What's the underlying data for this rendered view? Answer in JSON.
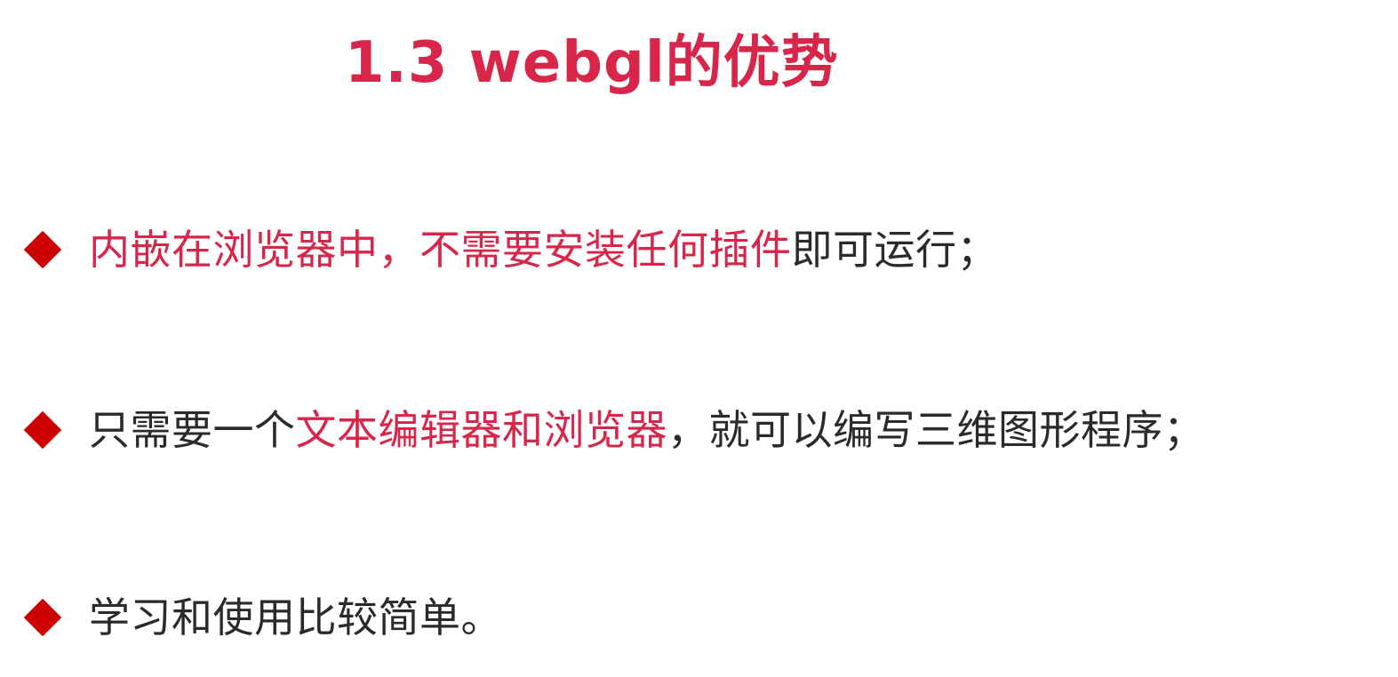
{
  "colors": {
    "accent": "#d8264a",
    "bullet": "#cc0000",
    "text": "#2a2a2a"
  },
  "slide": {
    "title": "1.3 webgl的优势",
    "bullets": [
      {
        "icon": "diamond-bullet-icon",
        "segments": [
          {
            "text": "内嵌在浏览器中，不需要安装任何插件",
            "highlight": true
          },
          {
            "text": "即可运行；",
            "highlight": false
          }
        ]
      },
      {
        "icon": "diamond-bullet-icon",
        "segments": [
          {
            "text": "只需要一个",
            "highlight": false
          },
          {
            "text": "文本编辑器和浏览器",
            "highlight": true
          },
          {
            "text": "，就可以编写三维图形程序；",
            "highlight": false
          }
        ]
      },
      {
        "icon": "diamond-bullet-icon",
        "segments": [
          {
            "text": "学习和使用比较简单。",
            "highlight": false
          }
        ]
      }
    ]
  }
}
